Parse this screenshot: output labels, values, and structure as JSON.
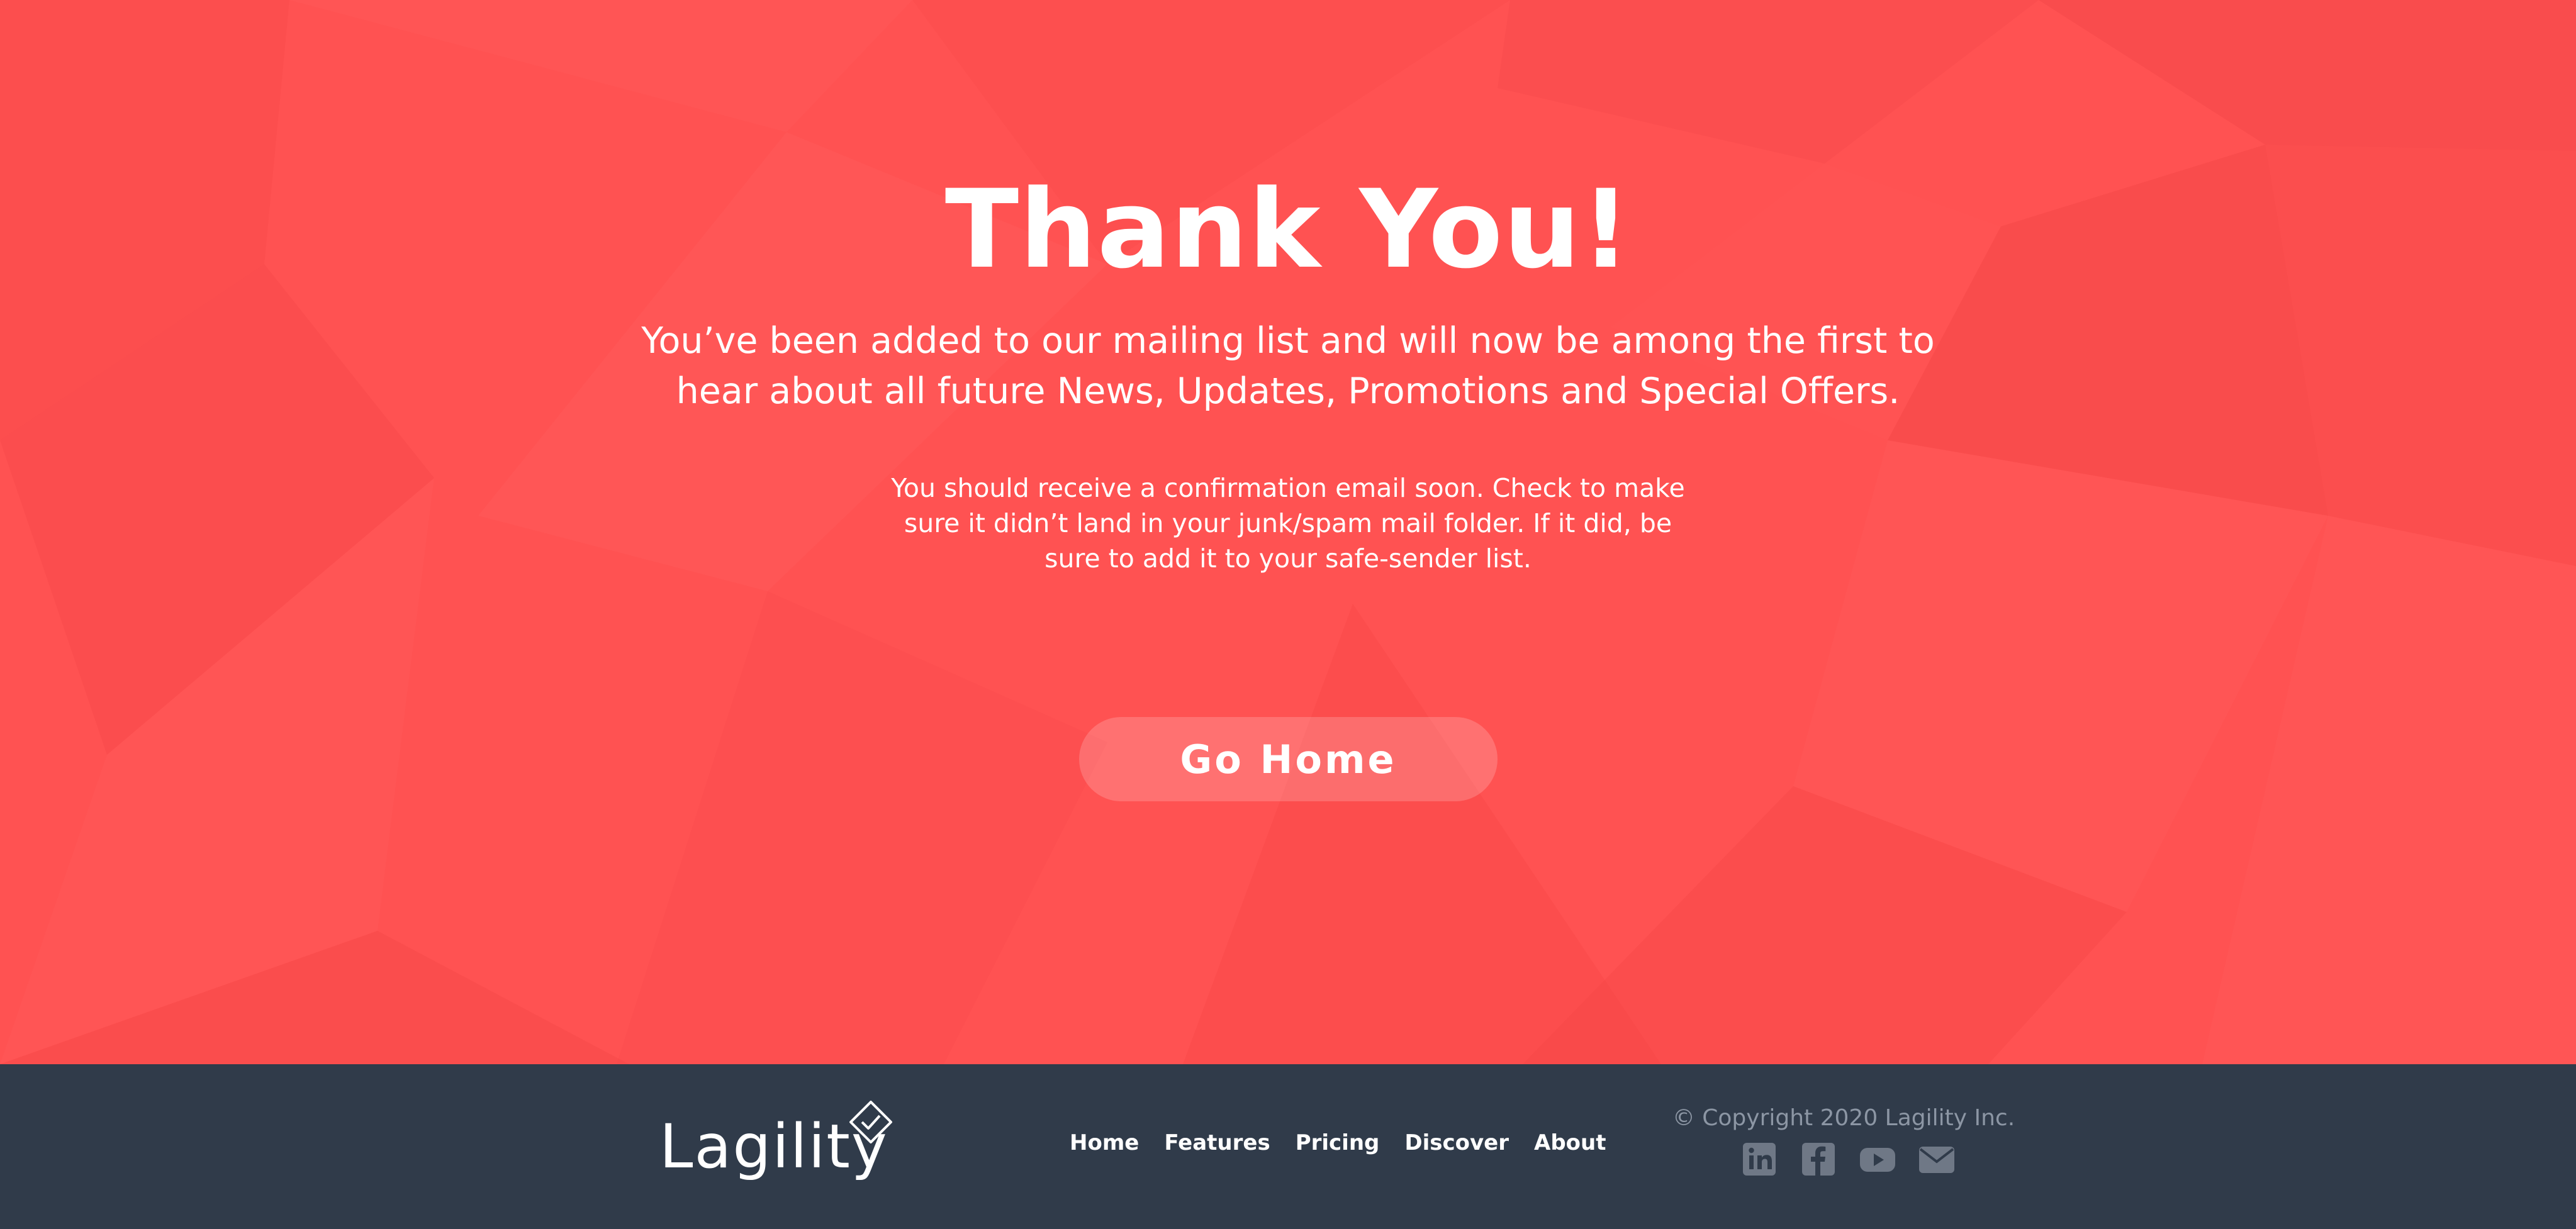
{
  "hero": {
    "title": "Thank You!",
    "subtitle": "You’ve been added to our mailing list and will now be among the first to hear about all future News, Updates, Promotions and Special Offers.",
    "note": "You should receive a confirmation email soon. Check to make sure it didn’t land in your junk/spam mail folder. If it did, be sure to add it to your safe-sender list.",
    "button_label": "Go Home",
    "background_color": "#ff5252"
  },
  "footer": {
    "logo_text": "Lagility",
    "nav": [
      "Home",
      "Features",
      "Pricing",
      "Discover",
      "About"
    ],
    "copyright": "© Copyright 2020 Lagility Inc.",
    "social_icons": [
      "linkedin-icon",
      "facebook-icon",
      "youtube-icon",
      "email-icon"
    ],
    "background_color": "#303b4a"
  }
}
